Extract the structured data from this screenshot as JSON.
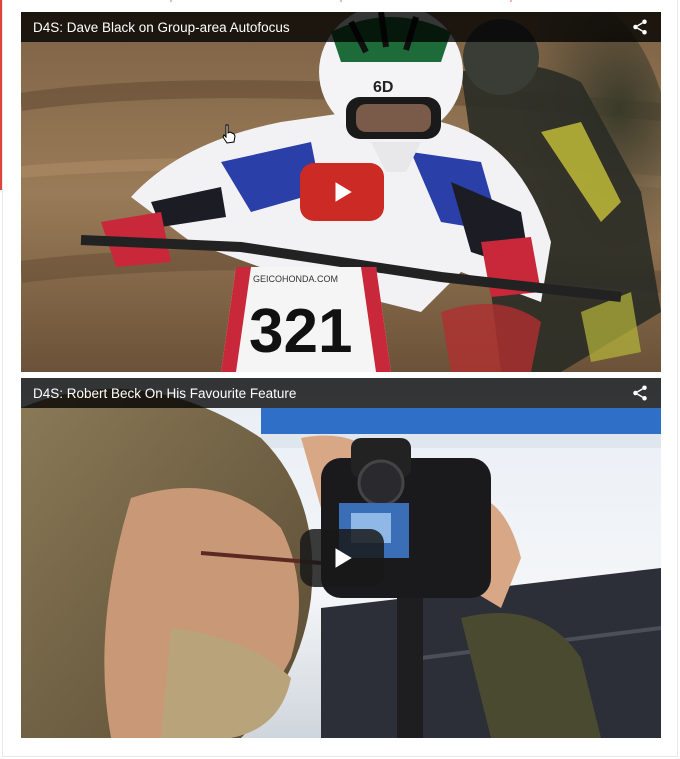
{
  "videos": [
    {
      "title": "D4S: Dave Black on Group-area Autofocus",
      "play_icon": "play-icon",
      "share_icon": "share-icon",
      "bib_number": "321",
      "sponsor_text": "GEICOHONDA.COM",
      "helmet_brand": "6D",
      "play_color": "#cc2a25"
    },
    {
      "title": "D4S: Robert Beck On His Favourite Feature",
      "play_icon": "play-icon",
      "share_icon": "share-icon",
      "play_color": "#1a1a1a"
    }
  ],
  "colors": {
    "title_bar_bg": "#000000",
    "accent_red": "#e0413a"
  }
}
